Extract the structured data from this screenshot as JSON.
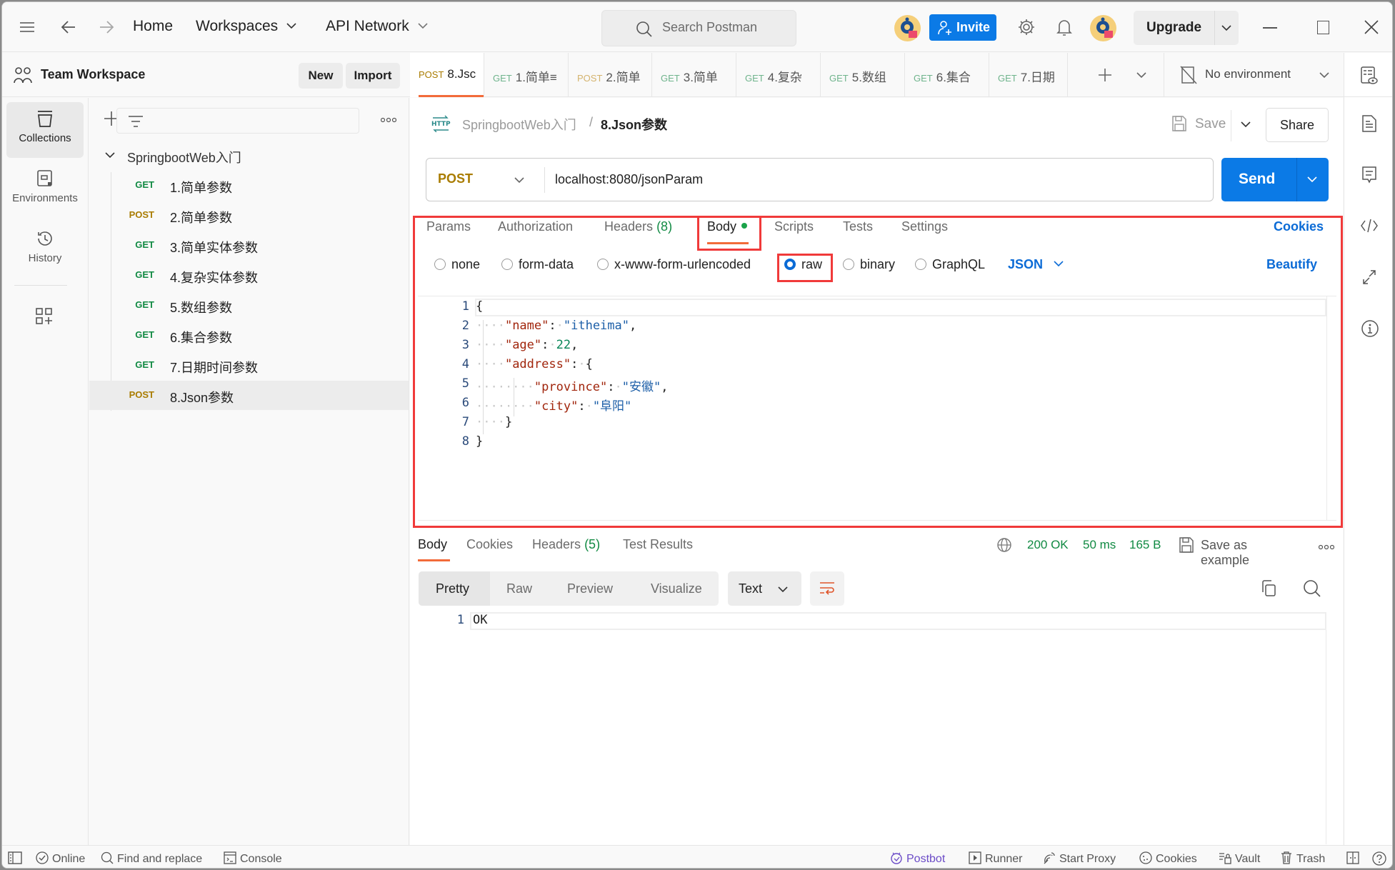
{
  "titlebar": {
    "nav": {
      "home": "Home",
      "workspaces": "Workspaces",
      "api_network": "API Network"
    },
    "search_placeholder": "Search Postman",
    "invite_label": "Invite",
    "upgrade_label": "Upgrade"
  },
  "workspace": {
    "name": "Team Workspace",
    "new_label": "New",
    "import_label": "Import"
  },
  "request_tabs": [
    {
      "method": "POST",
      "name": "8.Jsc",
      "active": true
    },
    {
      "method": "GET",
      "name": "1.简单≡"
    },
    {
      "method": "POST",
      "name": "2.简单"
    },
    {
      "method": "GET",
      "name": "3.简单"
    },
    {
      "method": "GET",
      "name": "4.复杂"
    },
    {
      "method": "GET",
      "name": "5.数组"
    },
    {
      "method": "GET",
      "name": "6.集合"
    },
    {
      "method": "GET",
      "name": "7.日期"
    }
  ],
  "environment": {
    "label": "No environment"
  },
  "rail": {
    "items": [
      {
        "label": "Collections",
        "icon": "collections-icon",
        "active": true
      },
      {
        "label": "Environments",
        "icon": "environments-icon"
      },
      {
        "label": "History",
        "icon": "history-icon"
      }
    ]
  },
  "sidebar": {
    "collection": "SpringbootWeb入门",
    "requests": [
      {
        "method": "GET",
        "name": "1.简单参数"
      },
      {
        "method": "POST",
        "name": "2.简单参数"
      },
      {
        "method": "GET",
        "name": "3.简单实体参数"
      },
      {
        "method": "GET",
        "name": "4.复杂实体参数"
      },
      {
        "method": "GET",
        "name": "5.数组参数"
      },
      {
        "method": "GET",
        "name": "6.集合参数"
      },
      {
        "method": "GET",
        "name": "7.日期时间参数"
      },
      {
        "method": "POST",
        "name": "8.Json参数",
        "active": true
      }
    ]
  },
  "request": {
    "breadcrumb_parent": "SpringbootWeb入门",
    "breadcrumb_sep": "/",
    "breadcrumb_current": "8.Json参数",
    "save_label": "Save",
    "share_label": "Share",
    "method": "POST",
    "url": "localhost:8080/jsonParam",
    "send_label": "Send",
    "tabs": {
      "params": "Params",
      "authorization": "Authorization",
      "headers": "Headers",
      "headers_count": "(8)",
      "body": "Body",
      "scripts": "Scripts",
      "tests": "Tests",
      "settings": "Settings",
      "cookies": "Cookies"
    },
    "body_modes": {
      "none": "none",
      "form_data": "form-data",
      "urlencoded": "x-www-form-urlencoded",
      "raw": "raw",
      "binary": "binary",
      "graphql": "GraphQL",
      "selected": "raw",
      "language": "JSON",
      "beautify": "Beautify"
    },
    "body_lines": [
      "{",
      "    \"name\": \"itheima\",",
      "    \"age\": 22,",
      "    \"address\": {",
      "        \"province\": \"安徽\",",
      "        \"city\": \"阜阳\"",
      "    }",
      "}"
    ]
  },
  "response": {
    "tabs": {
      "body": "Body",
      "cookies": "Cookies",
      "headers": "Headers",
      "headers_count": "(5)",
      "test_results": "Test Results"
    },
    "status": "200 OK",
    "time": "50 ms",
    "size": "165 B",
    "save_example": "Save as example",
    "views": {
      "pretty": "Pretty",
      "raw": "Raw",
      "preview": "Preview",
      "visualize": "Visualize"
    },
    "format": "Text",
    "lines": [
      "OK"
    ]
  },
  "statusbar": {
    "online": "Online",
    "find_replace": "Find and replace",
    "console": "Console",
    "postbot": "Postbot",
    "runner": "Runner",
    "start_proxy": "Start Proxy",
    "cookies": "Cookies",
    "vault": "Vault",
    "trash": "Trash"
  },
  "colors": {
    "accent_blue": "#0b7ae6",
    "get": "#118a43",
    "post": "#a97c00",
    "tab_underline": "#f26b3a",
    "highlight_box": "#f03a3a",
    "postbot": "#6b4bc7"
  }
}
